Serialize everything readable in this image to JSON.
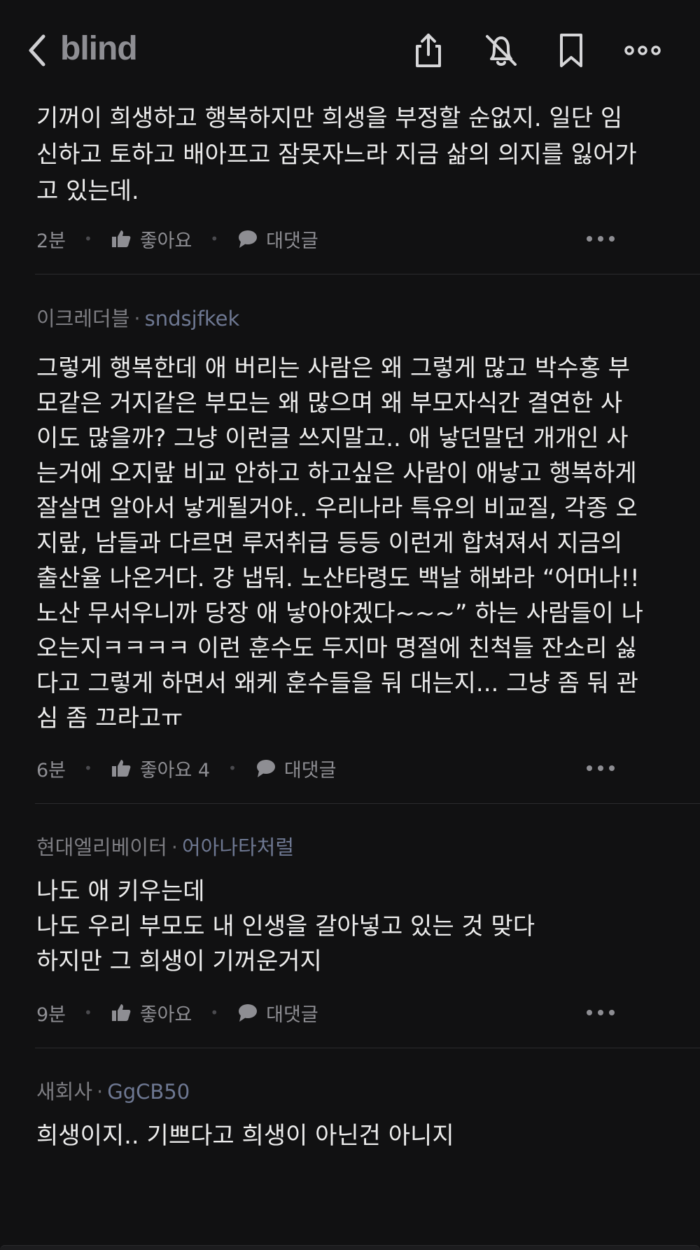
{
  "header": {
    "logo": "blind",
    "icons": [
      "back-icon",
      "share-icon",
      "notifications-off-icon",
      "bookmark-icon",
      "more-icon"
    ]
  },
  "comments": [
    {
      "author": "",
      "nickname": "",
      "body": "기꺼이 희생하고 행복하지만 희생을 부정할 순없지. 일단 임\n신하고 토하고 배아프고 잠못자느라 지금 삶의 의지를 잃어가\n고 있는데.",
      "time": "2분",
      "like_label": "좋아요",
      "reply_label": "대댓글"
    },
    {
      "author": "이크레더블",
      "nickname": "sndsjfkek",
      "body": "그렇게 행복한데 애 버리는 사람은 왜 그렇게 많고 박수홍 부\n모같은 거지같은 부모는 왜 많으며 왜 부모자식간 결연한 사\n이도 많을까? 그냥 이런글 쓰지말고.. 애 낳던말던 개개인 사\n는거에 오지랖 비교 안하고 하고싶은 사람이 애낳고 행복하게\n잘살면 알아서 낳게될거야.. 우리나라 특유의 비교질, 각종 오\n지랖, 남들과 다르면 루저취급 등등 이런게 합쳐져서 지금의\n출산율 나온거다. 걍 냅둬. 노산타령도 백날 해봐라 “어머나!!\n노산 무서우니까 당장 애 낳아야겠다~~~” 하는 사람들이 나\n오는지ㅋㅋㅋㅋ 이런 훈수도 두지마 명절에 친척들 잔소리 싫\n다고 그렇게 하면서 왜케 훈수들을 둬 대는지... 그냥 좀 둬 관\n심 좀 끄라고ㅠ",
      "time": "6분",
      "like_label": "좋아요 4",
      "reply_label": "대댓글"
    },
    {
      "author": "현대엘리베이터",
      "nickname": "어아나타처럴",
      "body": "나도 애 키우는데\n나도 우리 부모도 내 인생을 갈아넣고 있는 것 맞다\n하지만 그 희생이 기꺼운거지",
      "time": "9분",
      "like_label": "좋아요",
      "reply_label": "대댓글"
    },
    {
      "author": "새회사",
      "nickname": "GgCB50",
      "body": "희생이지.. 기쁘다고 희생이 아닌건 아니지",
      "time": "",
      "like_label": "",
      "reply_label": ""
    }
  ],
  "colors": {
    "background": "#111112",
    "text": "#ececec",
    "muted": "#8e8e93",
    "nickname": "#6e7892"
  }
}
